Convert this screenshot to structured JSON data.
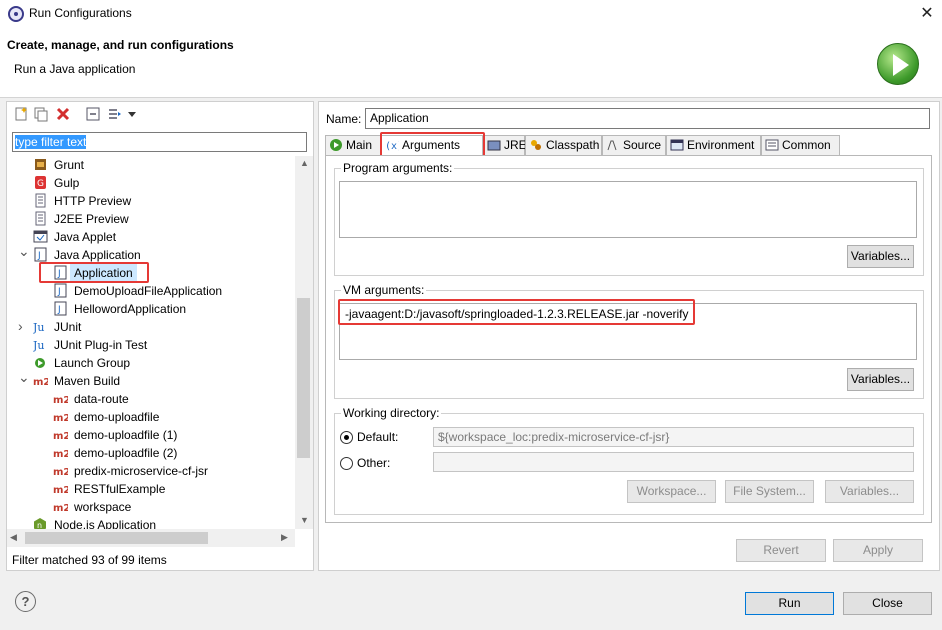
{
  "window": {
    "title": "Run Configurations",
    "close_glyph": "✕"
  },
  "banner": {
    "title": "Create, manage, and run configurations",
    "subtitle": "Run a Java application",
    "logo_icon": "run-icon"
  },
  "left": {
    "filter_text": "type filter text",
    "tree": [
      {
        "label": "Grunt",
        "icon": "grunt-icon",
        "indent": 1
      },
      {
        "label": "Gulp",
        "icon": "gulp-icon",
        "indent": 1
      },
      {
        "label": "HTTP Preview",
        "icon": "http-preview-icon",
        "indent": 1
      },
      {
        "label": "J2EE Preview",
        "icon": "j2ee-preview-icon",
        "indent": 1
      },
      {
        "label": "Java Applet",
        "icon": "java-applet-icon",
        "indent": 1
      },
      {
        "label": "Java Application",
        "icon": "java-application-icon",
        "indent": 1,
        "expanded": true
      },
      {
        "label": "Application",
        "icon": "java-class-icon",
        "indent": 2,
        "selected": true
      },
      {
        "label": "DemoUploadFileApplication",
        "icon": "java-class-icon",
        "indent": 2
      },
      {
        "label": "HellowordApplication",
        "icon": "java-class-icon",
        "indent": 2
      },
      {
        "label": "JUnit",
        "icon": "junit-icon",
        "indent": 1,
        "collapsed": true
      },
      {
        "label": "JUnit Plug-in Test",
        "icon": "junit-plugin-icon",
        "indent": 1
      },
      {
        "label": "Launch Group",
        "icon": "launch-group-icon",
        "indent": 1
      },
      {
        "label": "Maven Build",
        "icon": "maven-icon",
        "indent": 1,
        "expanded": true
      },
      {
        "label": "data-route",
        "icon": "maven-icon",
        "indent": 2
      },
      {
        "label": "demo-uploadfile",
        "icon": "maven-icon",
        "indent": 2
      },
      {
        "label": "demo-uploadfile (1)",
        "icon": "maven-icon",
        "indent": 2
      },
      {
        "label": "demo-uploadfile (2)",
        "icon": "maven-icon",
        "indent": 2
      },
      {
        "label": "predix-microservice-cf-jsr",
        "icon": "maven-icon",
        "indent": 2
      },
      {
        "label": "RESTfulExample",
        "icon": "maven-icon",
        "indent": 2
      },
      {
        "label": "workspace",
        "icon": "maven-icon",
        "indent": 2
      },
      {
        "label": "Node.js Application",
        "icon": "nodejs-icon",
        "indent": 1
      }
    ],
    "status": "Filter matched 93 of 99 items"
  },
  "right": {
    "name_label": "Name:",
    "name_value": "Application",
    "tabs": [
      {
        "label": "Main",
        "icon": "main-tab-icon"
      },
      {
        "label": "Arguments",
        "icon": "arguments-tab-icon"
      },
      {
        "label": "JRE",
        "icon": "jre-tab-icon"
      },
      {
        "label": "Classpath",
        "icon": "classpath-tab-icon"
      },
      {
        "label": "Source",
        "icon": "source-tab-icon"
      },
      {
        "label": "Environment",
        "icon": "environment-tab-icon"
      },
      {
        "label": "Common",
        "icon": "common-tab-icon"
      }
    ],
    "program_args_label": "Program arguments:",
    "program_args_value": "",
    "vm_args_label": "VM arguments:",
    "vm_args_value": "-javaagent:D:/javasoft/springloaded-1.2.3.RELEASE.jar  -noverify",
    "variables_label": "Variables...",
    "working_dir_label": "Working directory:",
    "default_label": "Default:",
    "default_value": "${workspace_loc:predix-microservice-cf-jsr}",
    "other_label": "Other:",
    "workspace_btn": "Workspace...",
    "filesystem_btn": "File System...",
    "revert_btn": "Revert",
    "apply_btn": "Apply"
  },
  "footer": {
    "run_btn": "Run",
    "close_btn": "Close",
    "help_glyph": "?"
  },
  "colors": {
    "accent": "#0078d7",
    "highlight": "#e53935",
    "selection": "#3399ff"
  }
}
